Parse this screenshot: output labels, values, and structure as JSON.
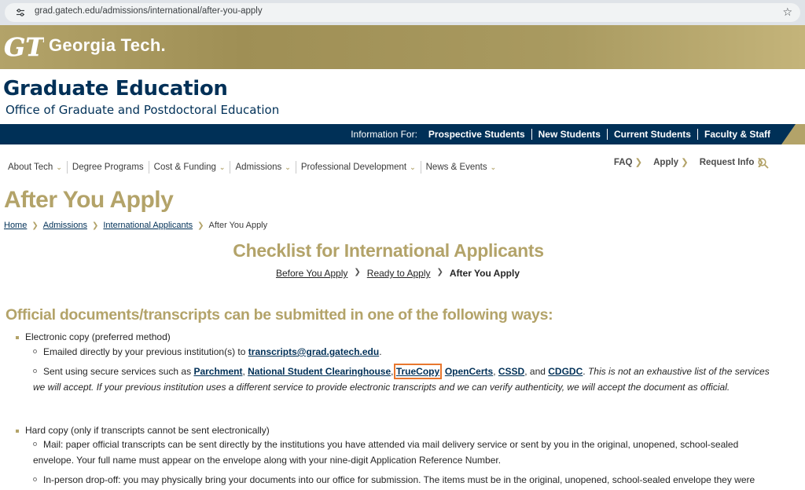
{
  "browser": {
    "url": "grad.gatech.edu/admissions/international/after-you-apply"
  },
  "banner": {
    "logo_text": "GT",
    "name": "Georgia Tech."
  },
  "site": {
    "title": "Graduate Education",
    "subtitle": "Office of Graduate and Postdoctoral Education"
  },
  "audience": {
    "label": "Information For:",
    "links": [
      "Prospective Students",
      "New Students",
      "Current Students",
      "Faculty & Staff"
    ]
  },
  "nav": {
    "items": [
      "About Tech",
      "Degree Programs",
      "Cost & Funding",
      "Admissions",
      "Professional Development",
      "News & Events"
    ],
    "util": [
      "FAQ",
      "Apply",
      "Request Info"
    ]
  },
  "page": {
    "title": "After You Apply",
    "breadcrumb": [
      "Home",
      "Admissions",
      "International Applicants",
      "After You Apply"
    ]
  },
  "checklist": {
    "title": "Checklist for International Applicants",
    "steps": [
      "Before You Apply",
      "Ready to Apply",
      "After You Apply"
    ]
  },
  "docs": {
    "heading": "Official documents/transcripts can be submitted in one of the following ways:",
    "electronic": {
      "label": "Electronic copy (preferred method)",
      "email_prefix": "Emailed directly by your previous institution(s) to ",
      "email": "transcripts@grad.gatech.edu",
      "email_suffix": ".",
      "services_prefix": "Sent using secure services such as ",
      "services": [
        "Parchment",
        "National Student Clearinghouse",
        "TrueCopy",
        "OpenCerts",
        "CSSD",
        "CDGDC"
      ],
      "services_and": "and",
      "services_note": "This is not an exhaustive list of the services we will accept. If your previous institution uses a different service to provide electronic transcripts and we can verify authenticity, we will accept the document as official."
    },
    "hard": {
      "label": "Hard copy (only if transcripts cannot be sent electronically)",
      "mail": "Mail: paper official transcripts can be sent directly by the institutions you have attended via mail delivery service or sent by you in the original, unopened, school-sealed envelope. Your full name must appear on the envelope along with your nine-digit Application Reference Number.",
      "dropoff": "In-person drop-off: you may physically bring your documents into our office for submission. The items must be in the original, unopened, school-sealed envelope they were"
    }
  }
}
